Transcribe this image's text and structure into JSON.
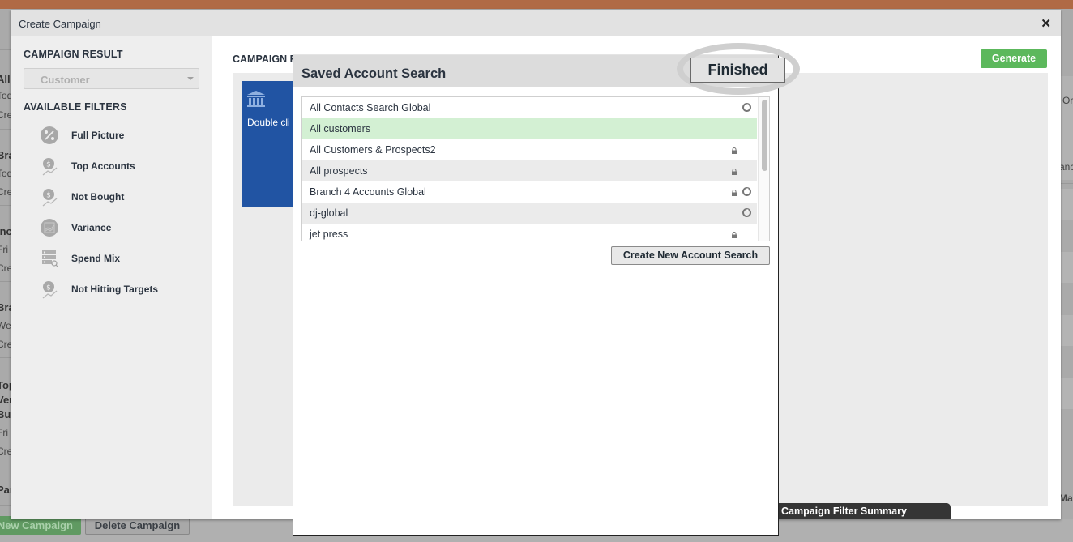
{
  "background": {
    "left_snippets": [
      {
        "text": "All p",
        "bold": true
      },
      {
        "text": "Today",
        "bold": false
      },
      {
        "text": "Creat",
        "bold": false
      },
      {
        "text": "Bran",
        "bold": true
      },
      {
        "text": "Today",
        "bold": false
      },
      {
        "text": "Creat",
        "bold": false
      },
      {
        "text": "Inc",
        "bold": true
      },
      {
        "text": "Fri J",
        "bold": false
      },
      {
        "text": "Creat",
        "bold": false
      },
      {
        "text": "Bran",
        "bold": true
      },
      {
        "text": "Wed",
        "bold": false
      },
      {
        "text": "Creat",
        "bold": false
      },
      {
        "text": "Top",
        "bold": true
      },
      {
        "text": "Very",
        "bold": true
      },
      {
        "text": "Buyo",
        "bold": true
      },
      {
        "text": "Fri C",
        "bold": false
      },
      {
        "text": "Creat",
        "bold": false
      },
      {
        "text": "Part",
        "bold": true
      }
    ],
    "right_snippets": [
      "Or",
      "anc",
      "Map"
    ],
    "new_campaign_label": "New Campaign",
    "delete_campaign_label": "Delete Campaign"
  },
  "create_campaign": {
    "title": "Create Campaign",
    "close_icon": "close-icon",
    "left_panel": {
      "campaign_result_label": "CAMPAIGN RESULT",
      "campaign_result_value": "Customer",
      "available_filters_label": "AVAILABLE FILTERS",
      "filters": [
        {
          "label": "Full Picture",
          "icon": "percent-circle-icon"
        },
        {
          "label": "Top Accounts",
          "icon": "dollar-trend-icon"
        },
        {
          "label": "Not Bought",
          "icon": "dollar-trend-icon"
        },
        {
          "label": "Variance",
          "icon": "area-chart-circle-icon"
        },
        {
          "label": "Spend Mix",
          "icon": "list-search-icon"
        },
        {
          "label": "Not Hitting Targets",
          "icon": "dollar-trend-icon"
        }
      ]
    },
    "right_panel": {
      "label": "CAMPAIGN F",
      "generate_label": "Generate",
      "card": {
        "icon": "bank-icon",
        "text": "Double cli"
      },
      "summary_tab_label": "Campaign Filter Summary"
    }
  },
  "saved_account_search": {
    "title": "Saved Account Search",
    "finished_label": "Finished",
    "items": [
      {
        "name": "All Contacts Search Global",
        "locked": false,
        "global": true,
        "selected": false
      },
      {
        "name": "All customers",
        "locked": false,
        "global": false,
        "selected": true
      },
      {
        "name": "All Customers & Prospects2",
        "locked": true,
        "global": false,
        "selected": false
      },
      {
        "name": "All prospects",
        "locked": true,
        "global": false,
        "selected": false
      },
      {
        "name": "Branch 4 Accounts Global",
        "locked": true,
        "global": true,
        "selected": false
      },
      {
        "name": "dj-global",
        "locked": false,
        "global": true,
        "selected": false
      },
      {
        "name": "jet press",
        "locked": true,
        "global": false,
        "selected": false
      }
    ],
    "create_new_label": "Create New Account Search"
  },
  "colors": {
    "accent_green": "#5cb85c",
    "selected_row": "#d3f0d3",
    "card_blue": "#2154a3",
    "top_bar": "#b06a45"
  }
}
